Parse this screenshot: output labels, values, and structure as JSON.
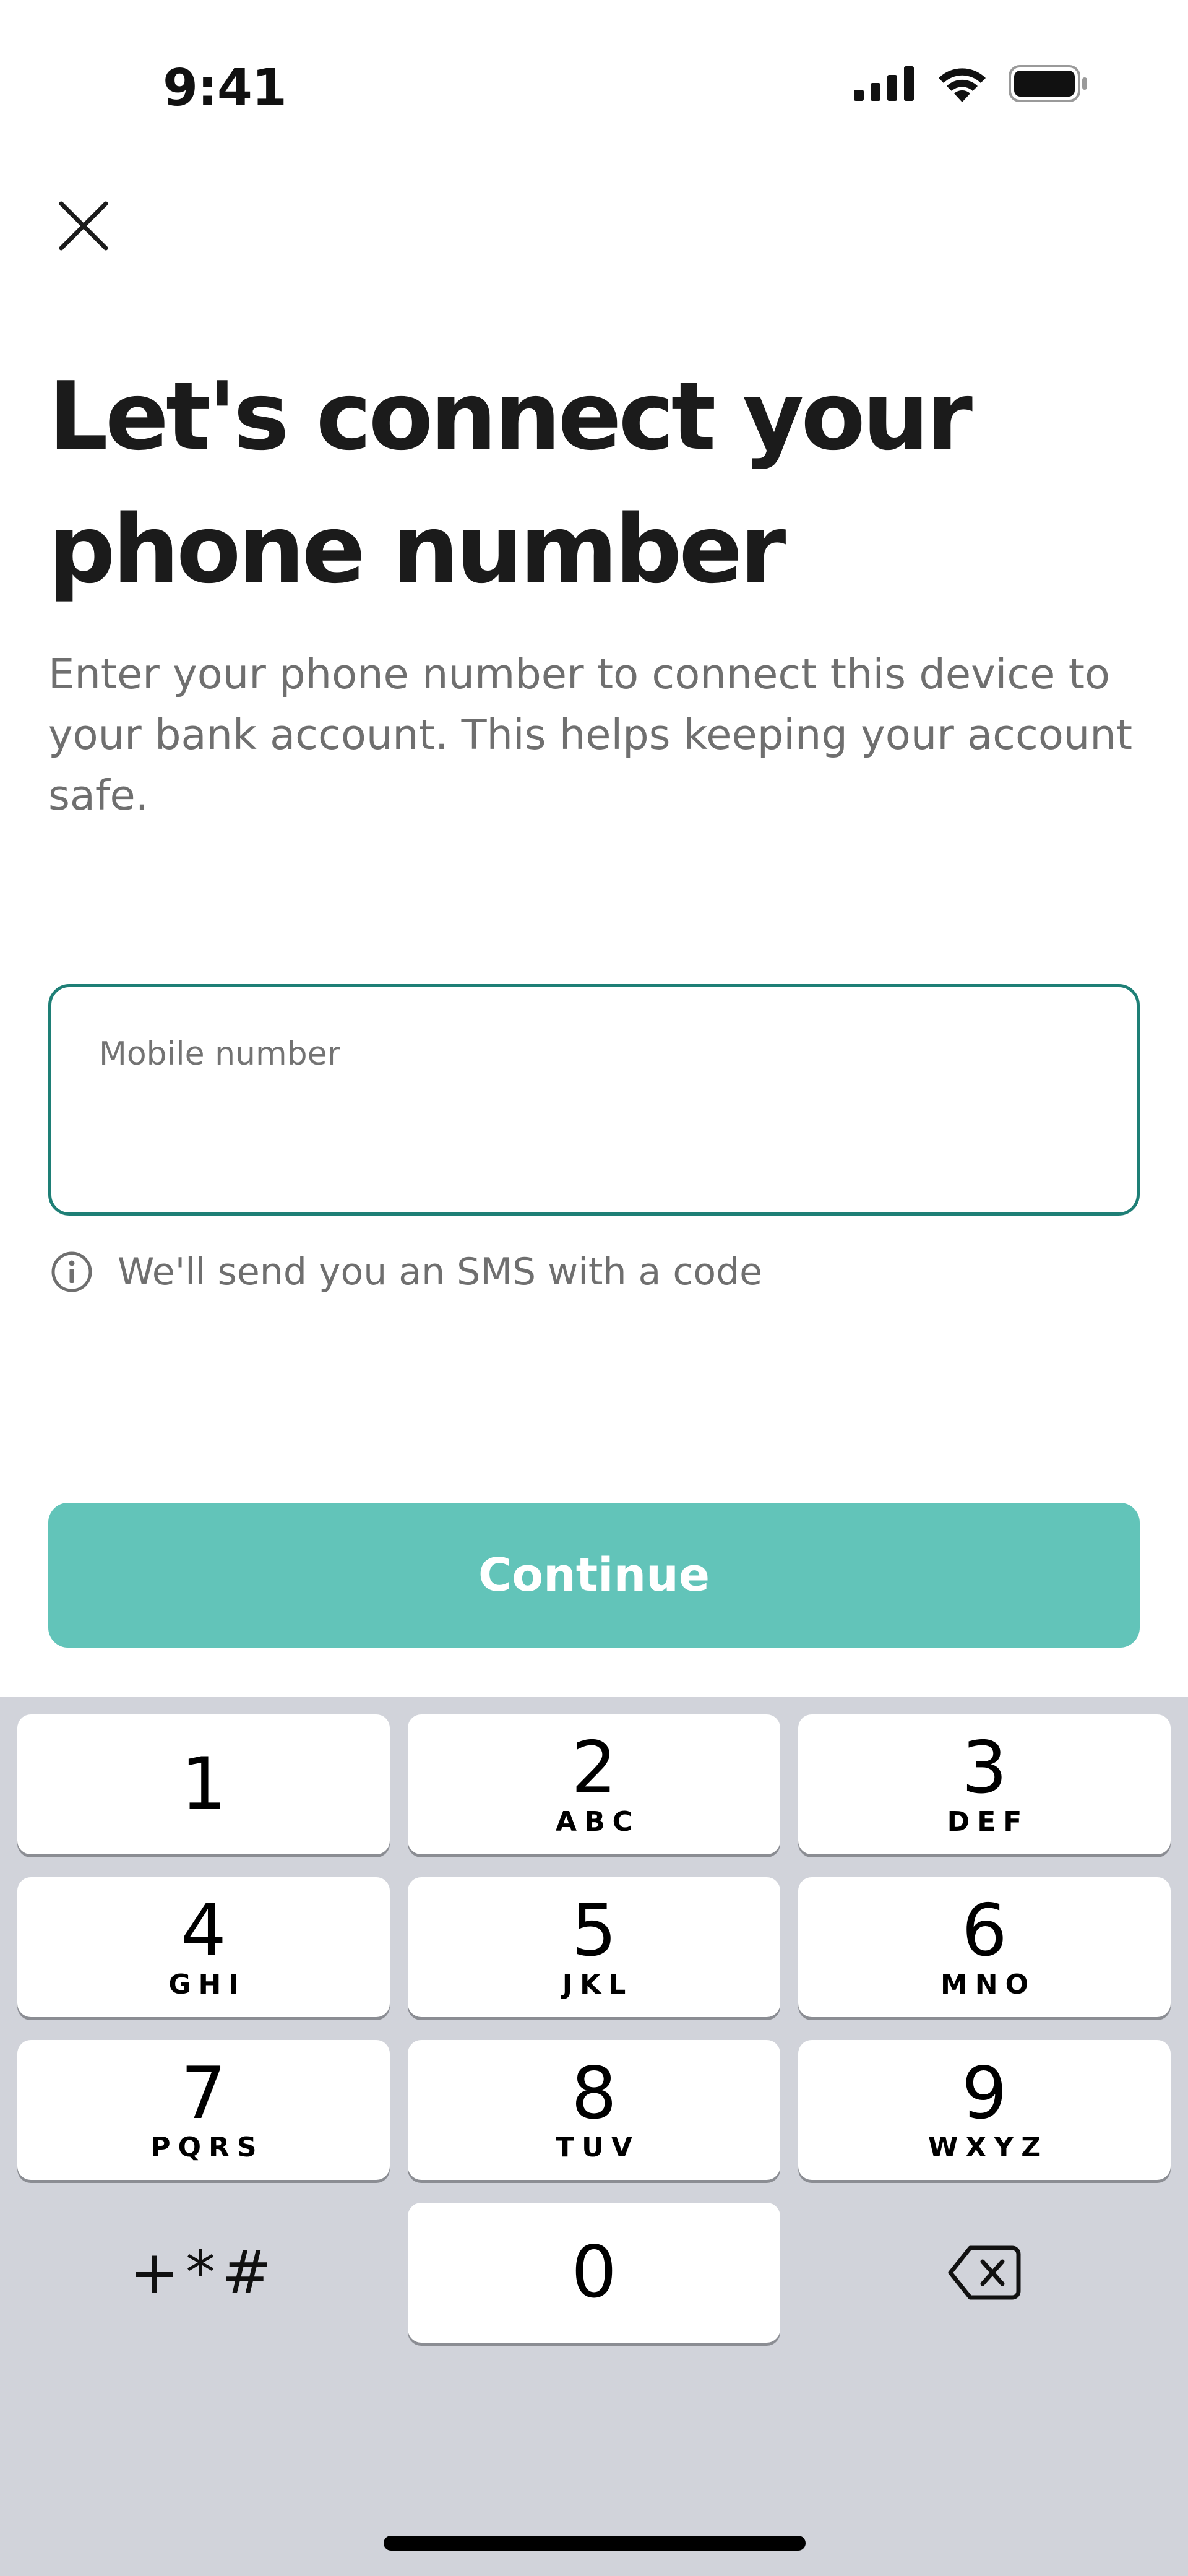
{
  "status_bar": {
    "time": "9:41",
    "icons": [
      "cellular-signal-icon",
      "wifi-icon",
      "battery-icon"
    ]
  },
  "header": {
    "close_icon": "close-icon"
  },
  "main": {
    "title": "Let's connect your phone number",
    "subtitle": "Enter your phone number to connect this device to your bank account. This helps keeping your account safe.",
    "input": {
      "label": "Mobile number",
      "value": "",
      "placeholder": ""
    },
    "hint": {
      "icon": "info-icon",
      "text": "We'll send you an SMS with a code"
    },
    "continue_label": "Continue"
  },
  "keypad": {
    "keys": [
      {
        "digit": "1",
        "letters": ""
      },
      {
        "digit": "2",
        "letters": "ABC"
      },
      {
        "digit": "3",
        "letters": "DEF"
      },
      {
        "digit": "4",
        "letters": "GHI"
      },
      {
        "digit": "5",
        "letters": "JKL"
      },
      {
        "digit": "6",
        "letters": "MNO"
      },
      {
        "digit": "7",
        "letters": "PQRS"
      },
      {
        "digit": "8",
        "letters": "TUV"
      },
      {
        "digit": "9",
        "letters": "WXYZ"
      },
      {
        "digit": "0",
        "letters": ""
      }
    ],
    "symbols_label": "+*#",
    "delete_icon": "backspace-icon"
  },
  "colors": {
    "accent": "#62c4b9",
    "input_border": "#1e7f76",
    "keypad_bg": "#d1d3da",
    "text_primary": "#1b1b1b",
    "text_secondary": "#6f6f6f"
  }
}
